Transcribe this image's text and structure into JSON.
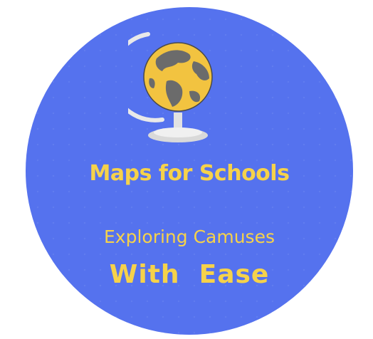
{
  "logo": {
    "title": "Maps for Schools",
    "subtitle": "Exploring Camuses",
    "tagline": "With  Ease",
    "icon": "globe-icon",
    "colors": {
      "background": "#5572ee",
      "text": "#f6d24a",
      "globe_ocean": "#f2c340",
      "globe_land": "#6b6b6b",
      "stand": "#dcdcdc"
    }
  }
}
